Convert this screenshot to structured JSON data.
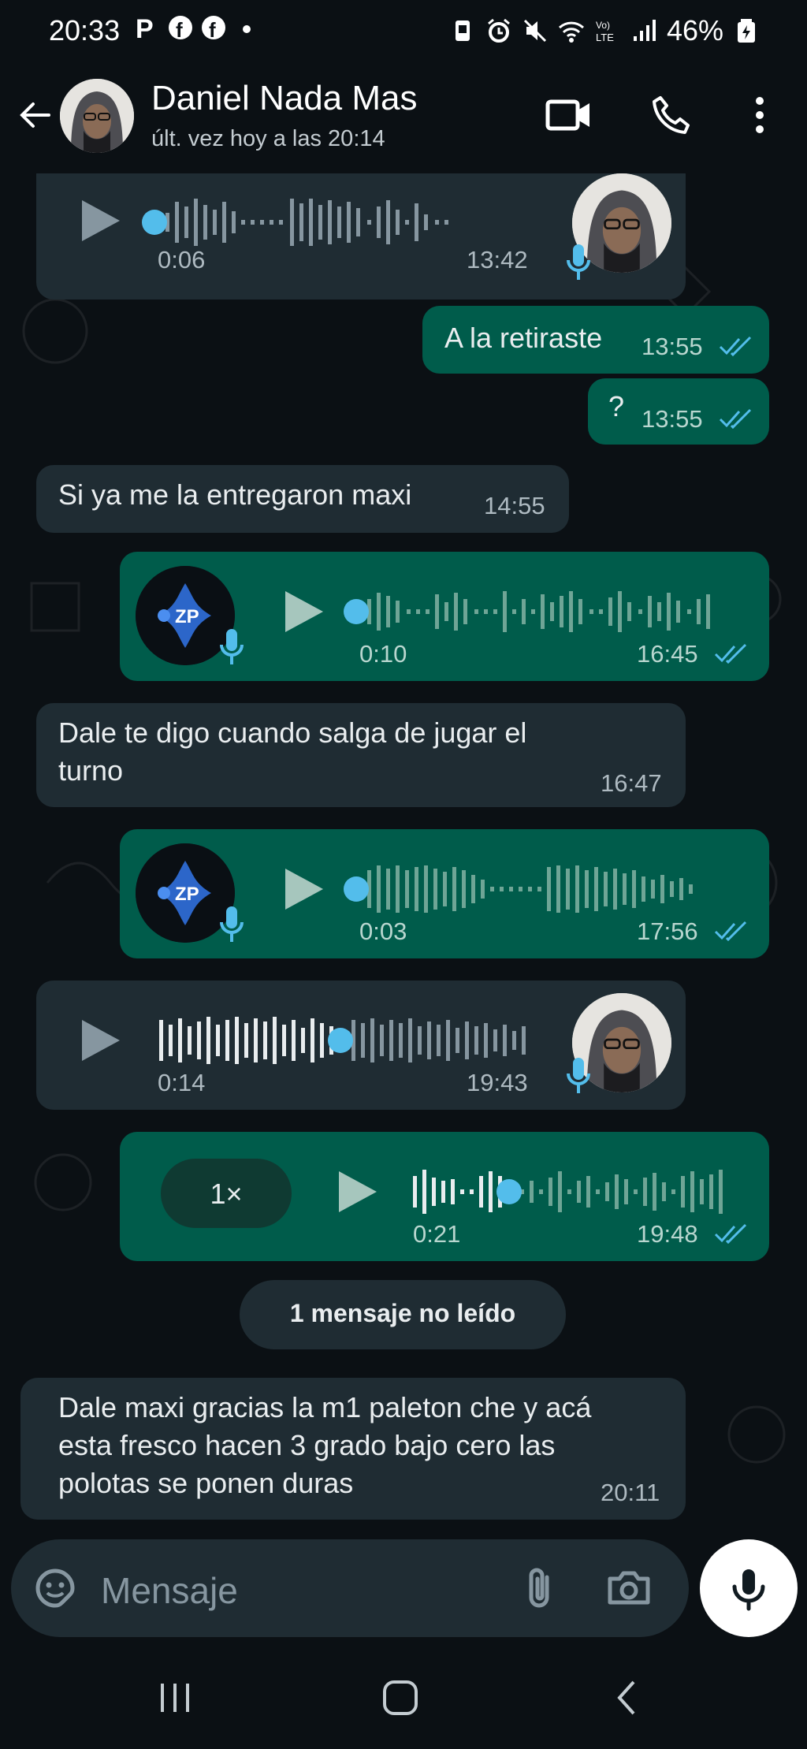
{
  "status_bar": {
    "time": "20:33",
    "battery": "46%",
    "network": "LTE"
  },
  "header": {
    "contact_name": "Daniel Nada Mas",
    "last_seen": "últ. vez hoy a las 20:14"
  },
  "messages": {
    "m1": {
      "type": "voice",
      "direction": "incoming",
      "duration": "0:06",
      "time": "13:42"
    },
    "m2": {
      "type": "text",
      "direction": "outgoing",
      "text": "A la retiraste",
      "time": "13:55"
    },
    "m3": {
      "type": "text",
      "direction": "outgoing",
      "text": "?",
      "time": "13:55"
    },
    "m4": {
      "type": "text",
      "direction": "incoming",
      "text": "Si ya me la entregaron maxi",
      "time": "14:55"
    },
    "m5": {
      "type": "voice",
      "direction": "outgoing",
      "duration": "0:10",
      "time": "16:45"
    },
    "m6": {
      "type": "text",
      "direction": "incoming",
      "line1": "Dale te digo cuando salga de jugar el",
      "line2": "turno",
      "time": "16:47"
    },
    "m7": {
      "type": "voice",
      "direction": "outgoing",
      "duration": "0:03",
      "time": "17:56"
    },
    "m8": {
      "type": "voice",
      "direction": "incoming",
      "duration": "0:14",
      "time": "19:43"
    },
    "m9": {
      "type": "voice",
      "direction": "outgoing",
      "speed": "1×",
      "duration": "0:21",
      "time": "19:48"
    },
    "unread_divider": "1 mensaje no leído",
    "m10": {
      "type": "text",
      "direction": "incoming",
      "line1": "Dale maxi gracias la m1 paleton che y acá",
      "line2": "esta fresco hacen 3 grado bajo cero las",
      "line3": "polotas se ponen duras",
      "time": "20:11"
    }
  },
  "input": {
    "placeholder": "Mensaje"
  },
  "colors": {
    "background": "#0b1014",
    "incoming_bubble": "#1f2c33",
    "outgoing_bubble": "#005c4b",
    "read_ticks": "#53bdeb",
    "playhead": "#53bdeb"
  }
}
